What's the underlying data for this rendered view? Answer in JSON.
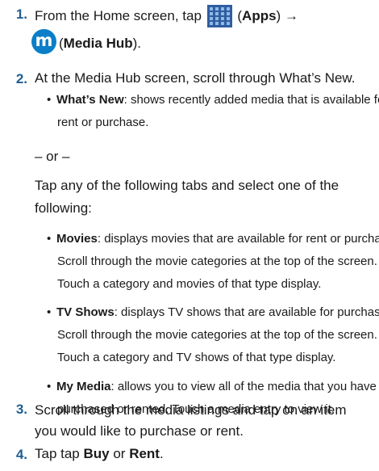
{
  "steps": [
    {
      "number": "1.",
      "parts": {
        "prefix": "From the Home screen, tap",
        "apps_label": "Apps",
        "arrow": "→",
        "hub_label": "Media Hub"
      }
    },
    {
      "number": "2.",
      "text": "At the Media Hub screen, scroll through What’s New.",
      "bullets_a": [
        {
          "term": "What’s New",
          "lines": [
            ": shows recently added media that is available for",
            "rent or purchase."
          ]
        }
      ],
      "or_text": "– or –",
      "tap_para": [
        "Tap any of the following tabs and select one of the",
        "following:"
      ],
      "bullets_b": [
        {
          "term": "Movies",
          "lines": [
            ": displays movies that are available for rent or purchase.",
            "Scroll through the movie categories at the top of the screen.",
            "Touch a category and movies of that type display."
          ]
        },
        {
          "term": "TV Shows",
          "lines": [
            ": displays TV shows that are available for purchase.",
            "Scroll through the movie categories at the top of the screen.",
            "Touch a category and TV shows of that type display."
          ]
        },
        {
          "term": "My Media",
          "lines": [
            ": allows you to view all of the media that you have",
            "purchased or rented. Touch a media entry to view it."
          ]
        }
      ]
    },
    {
      "number": "3.",
      "lines": [
        "Scroll through the media listings and tap on an item",
        "you would like to purchase or rent."
      ]
    },
    {
      "number": "4.",
      "parts": {
        "prefix": "Tap tap ",
        "buy": "Buy",
        "mid": " or ",
        "rent": "Rent",
        "suffix": "."
      }
    }
  ],
  "icons": {
    "apps": "apps-grid-icon",
    "media_hub": "media-hub-icon"
  },
  "colors": {
    "step_number": "#1f5e91",
    "apps_tile": "#2f5ea0",
    "media_hub": "#0a7fc7"
  }
}
